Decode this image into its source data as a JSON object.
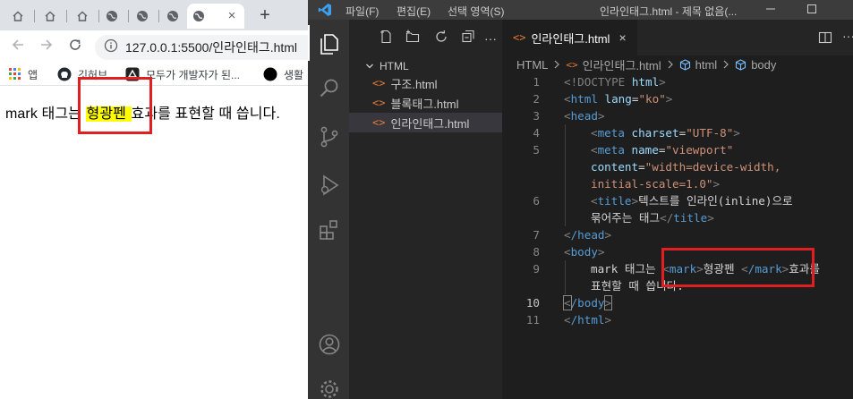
{
  "browser": {
    "tabs": [
      {
        "icon": "home-icon"
      },
      {
        "icon": "home-icon"
      },
      {
        "icon": "home-icon"
      },
      {
        "icon": "globe-icon"
      },
      {
        "icon": "globe-icon"
      },
      {
        "icon": "globe-icon"
      },
      {
        "icon": "globe-icon",
        "active": true
      }
    ],
    "close_label": "×",
    "newtab_label": "+",
    "url": "127.0.0.1:5500/인라인태그.html",
    "bookmarks": [
      {
        "label": "앱",
        "icon": "apps-grid-icon"
      },
      {
        "label": "깃허브",
        "icon": "github-icon"
      },
      {
        "label": "모두가 개발자가 된...",
        "icon": "bookmark-site-icon"
      },
      {
        "label": "생활",
        "icon": "black-dot-icon"
      }
    ],
    "content": {
      "before": "mark 태그는 ",
      "marked": "형광펜 ",
      "after": "효과를 표현할 때 씁니다."
    },
    "highlight_color": "#ffff00"
  },
  "vscode": {
    "menu": [
      "파일(F)",
      "편집(E)",
      "선택 영역(S)"
    ],
    "window_title": "인라인태그.html - 제목 없음(...",
    "explorer": {
      "folder": "HTML",
      "files": [
        "구조.html",
        "블록태그.html",
        "인라인태그.html"
      ],
      "active_file": "인라인태그.html"
    },
    "file_icon": "<>",
    "editor_tab": {
      "label": "인라인태그.html",
      "close": "×"
    },
    "breadcrumb": {
      "root": "HTML",
      "file": "인라인태그.html",
      "html": "html",
      "body": "body"
    },
    "line_numbers": [
      "1",
      "2",
      "3",
      "4",
      "5",
      "",
      "",
      "6",
      "",
      "7",
      "8",
      "9",
      "",
      "10",
      "11"
    ],
    "code": {
      "l1a": "<!DOCTYPE ",
      "l1b": "html",
      "l1c": ">",
      "l2_open": "<",
      "l2_tag": "html",
      "l2_attr": " lang",
      "l2_eq": "=",
      "l2_val": "\"ko\"",
      "l2_close": ">",
      "l3": "head",
      "l4_tag": "meta",
      "l4_attr": " charset",
      "l4_val": "\"UTF-8\"",
      "l5_tag": "meta",
      "l5_attr": " name",
      "l5_val": "\"viewport\"",
      "l5b_attr": "content",
      "l5b_val": "\"width=device-width,",
      "l5c_val": "initial-scale=1.0\"",
      "l6_tag": "title",
      "l6_text": "텍스트를 인라인(inline)으로",
      "l6b_text": "묶어주는 태그",
      "l7": "/head",
      "l8": "body",
      "l9_text1": "mark 태그는 ",
      "l9_tag": "mark",
      "l9_text2": "형광펜 ",
      "l9_ctag": "/mark",
      "l9_text3": "효과를",
      "l9b_text": "표현할 때 씁니다.",
      "l10": "/body",
      "l11": "/html"
    }
  },
  "colors": {
    "annotation_red": "#e02020",
    "vscode_bg": "#1e1e1e",
    "tag_blue": "#569cd6",
    "attr_lightblue": "#9cdcfe",
    "string_orange": "#ce9178"
  }
}
